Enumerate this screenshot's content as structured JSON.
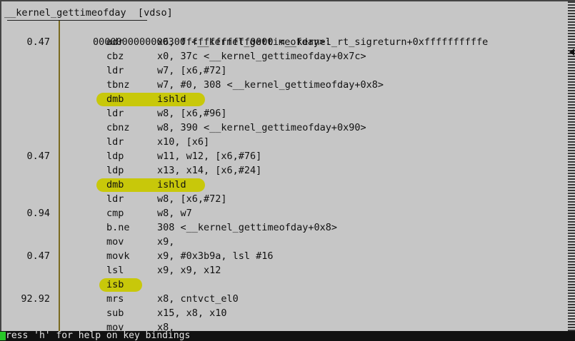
{
  "title": "__kernel_gettimeofday  [vdso]",
  "header_addr": "0000000000000300 <__kernel_gettimeofday>:",
  "rows": [
    {
      "pct": "0.47",
      "op": "adr",
      "args": "x6, ffffffffffff0000 <__kernel_rt_sigreturn+0xffffffffffe"
    },
    {
      "pct": "",
      "op": "cbz",
      "args": "x0, 37c <__kernel_gettimeofday+0x7c>"
    },
    {
      "pct": "",
      "op": "ldr",
      "args": "w7, [x6,#72]"
    },
    {
      "pct": "",
      "op": "tbnz",
      "args": "w7, #0, 308 <__kernel_gettimeofday+0x8>"
    },
    {
      "pct": "",
      "op": "dmb",
      "args": "ishld",
      "highlight": true
    },
    {
      "pct": "",
      "op": "ldr",
      "args": "w8, [x6,#96]"
    },
    {
      "pct": "",
      "op": "cbnz",
      "args": "w8, 390 <__kernel_gettimeofday+0x90>"
    },
    {
      "pct": "",
      "op": "ldr",
      "args": "x10, [x6]"
    },
    {
      "pct": "0.47",
      "op": "ldp",
      "args": "w11, w12, [x6,#76]"
    },
    {
      "pct": "",
      "op": "ldp",
      "args": "x13, x14, [x6,#24]"
    },
    {
      "pct": "",
      "op": "dmb",
      "args": "ishld",
      "highlight": true
    },
    {
      "pct": "",
      "op": "ldr",
      "args": "w8, [x6,#72]"
    },
    {
      "pct": "0.94",
      "op": "cmp",
      "args": "w8, w7"
    },
    {
      "pct": "",
      "op": "b.ne",
      "args": "308 <__kernel_gettimeofday+0x8>"
    },
    {
      "pct": "",
      "op": "mov",
      "args": "x9,"
    },
    {
      "pct": "0.47",
      "op": "movk",
      "args": "x9, #0x3b9a, lsl #16"
    },
    {
      "pct": "",
      "op": "lsl",
      "args": "x9, x9, x12"
    },
    {
      "pct": "",
      "op": "isb",
      "args": "",
      "highlight": true,
      "short": true
    },
    {
      "pct": "92.92",
      "op": "mrs",
      "args": "x8, cntvct_el0"
    },
    {
      "pct": "",
      "op": "sub",
      "args": "x15, x8, x10"
    },
    {
      "pct": "",
      "op": "mov",
      "args": "x8,"
    }
  ],
  "status_text": "ress 'h' for help on key bindings",
  "colors": {
    "background": "#c6c6c6",
    "highlight": "#c8c800",
    "statusbar": "#111111",
    "cursor": "#28c828"
  }
}
